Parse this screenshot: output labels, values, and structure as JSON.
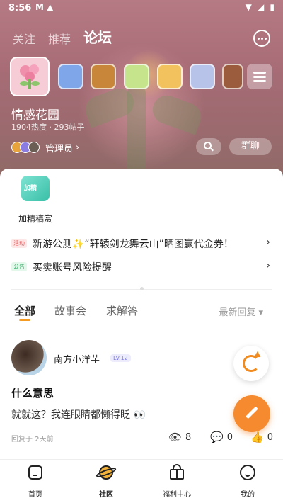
{
  "status_bar": {
    "time": "8:56",
    "icons_left": "M ▲",
    "icons_right": "▼ ◢ ▮"
  },
  "top_tabs": [
    "关注",
    "推荐",
    "论坛"
  ],
  "forum": {
    "name": "情感花园",
    "stats": "1904热度 · 293帖子",
    "admin_label": "管理员",
    "group_chat": "群聊",
    "icons": [
      {
        "name": "flower-bouquet",
        "color": "#f6cdd6"
      },
      {
        "name": "character-blue",
        "color": "#7fa6e8"
      },
      {
        "name": "hero-armor",
        "color": "#c7863a"
      },
      {
        "name": "flower-icon",
        "color": "#c6e48c"
      },
      {
        "name": "cake-icon",
        "color": "#f2c25f"
      },
      {
        "name": "anime-girl",
        "color": "#b7c3e8"
      },
      {
        "name": "warrior-icon",
        "color": "#9a5c3c"
      }
    ]
  },
  "badge": {
    "label": "加精稿赏",
    "icon_text": "加精"
  },
  "notices": [
    {
      "tag": "活动",
      "text": "新游公测✨“轩辕剑龙舞云山”晒图赢代金券！",
      "tag_color": "#e35b5b"
    },
    {
      "tag": "公告",
      "text": "买卖账号风险提醒",
      "tag_color": "#35b46a"
    }
  ],
  "sub_tabs": [
    "全部",
    "故事会",
    "求解答"
  ],
  "sort_label": "最新回复 ▾",
  "post": {
    "author": "南方小洋芋",
    "level": "LV.12",
    "title": "什么意思",
    "body": "就就这？我连眼睛都懒得眨 👀",
    "meta": "回复于 2天前",
    "views": "8",
    "comments": "0",
    "likes": "0"
  },
  "bottom_nav": [
    "首页",
    "社区",
    "福利中心",
    "我的"
  ],
  "accent": "#f58a2f"
}
